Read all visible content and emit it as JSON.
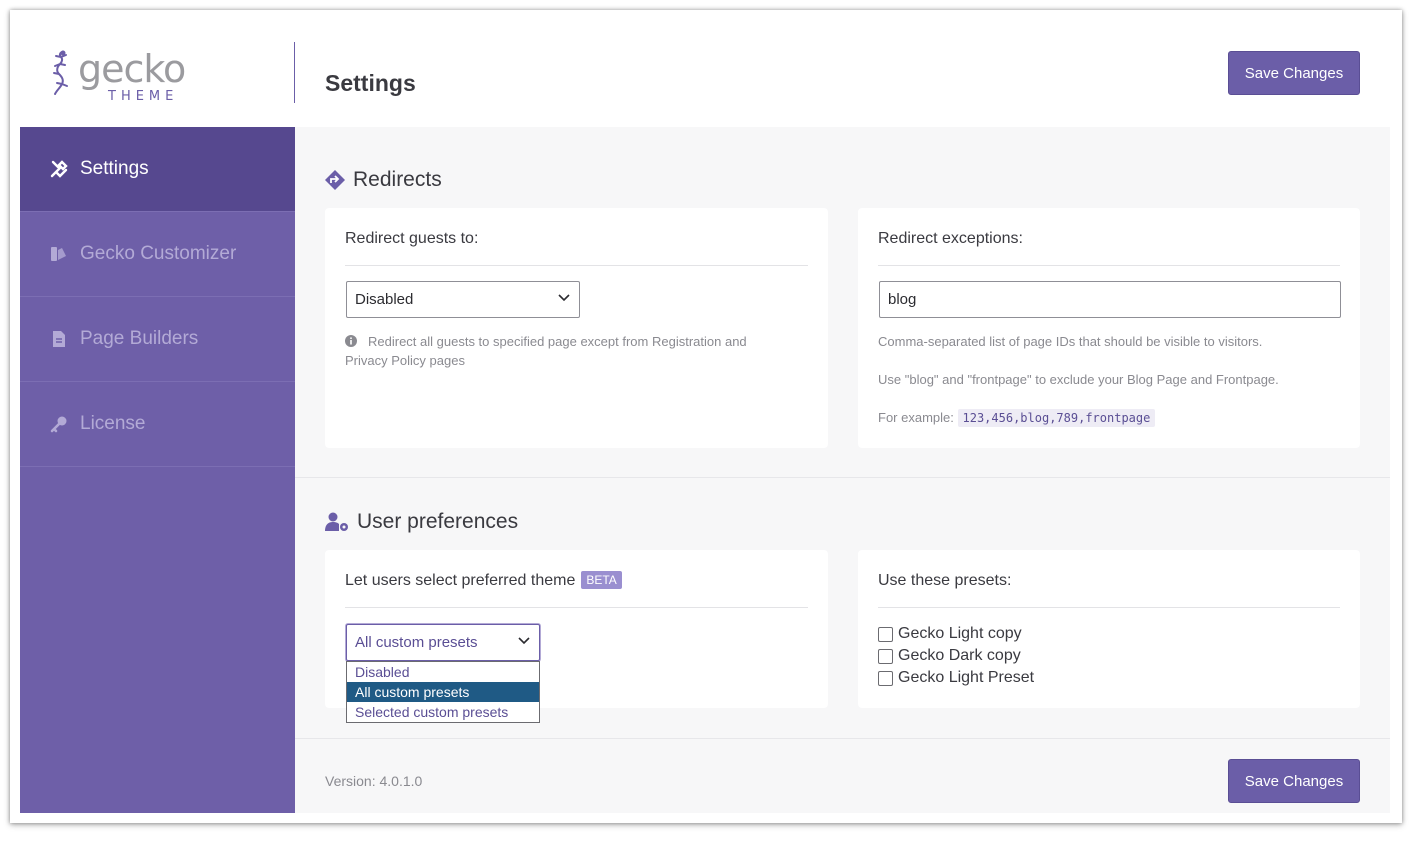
{
  "header": {
    "logo_text": "gecko",
    "logo_sub": "THEME",
    "title": "Settings",
    "save_label": "Save Changes"
  },
  "sidebar": {
    "items": [
      {
        "label": "Settings",
        "icon": "tools-icon",
        "active": true
      },
      {
        "label": "Gecko Customizer",
        "icon": "palette-icon",
        "active": false
      },
      {
        "label": "Page Builders",
        "icon": "document-icon",
        "active": false
      },
      {
        "label": "License",
        "icon": "key-icon",
        "active": false
      }
    ]
  },
  "redirects": {
    "title": "Redirects",
    "guests_label": "Redirect guests to:",
    "guests_value": "Disabled",
    "guests_help": "Redirect all guests to specified page except from Registration and Privacy Policy pages",
    "exceptions_label": "Redirect exceptions:",
    "exceptions_value": "blog",
    "exceptions_help1": "Comma-separated list of page IDs that should be visible to visitors.",
    "exceptions_help2": "Use \"blog\" and \"frontpage\" to exclude your Blog Page and Frontpage.",
    "example_label": "For example:",
    "example_code": "123,456,blog,789,frontpage"
  },
  "preferences": {
    "title": "User preferences",
    "theme_label": "Let users select preferred theme",
    "beta_badge": "BETA",
    "theme_value": "All custom presets",
    "options": [
      "Disabled",
      "All custom presets",
      "Selected custom presets"
    ],
    "selected_option": 1,
    "presets_label": "Use these presets:",
    "presets": [
      "Gecko Light copy",
      "Gecko Dark copy",
      "Gecko Light Preset"
    ]
  },
  "footer": {
    "version": "Version: 4.0.1.0",
    "save_label": "Save Changes"
  },
  "colors": {
    "accent": "#6b5ea8",
    "sidebar": "#6e5fa8",
    "sidebar_active": "#56488f",
    "dropdown_selected": "#1f5a85"
  }
}
